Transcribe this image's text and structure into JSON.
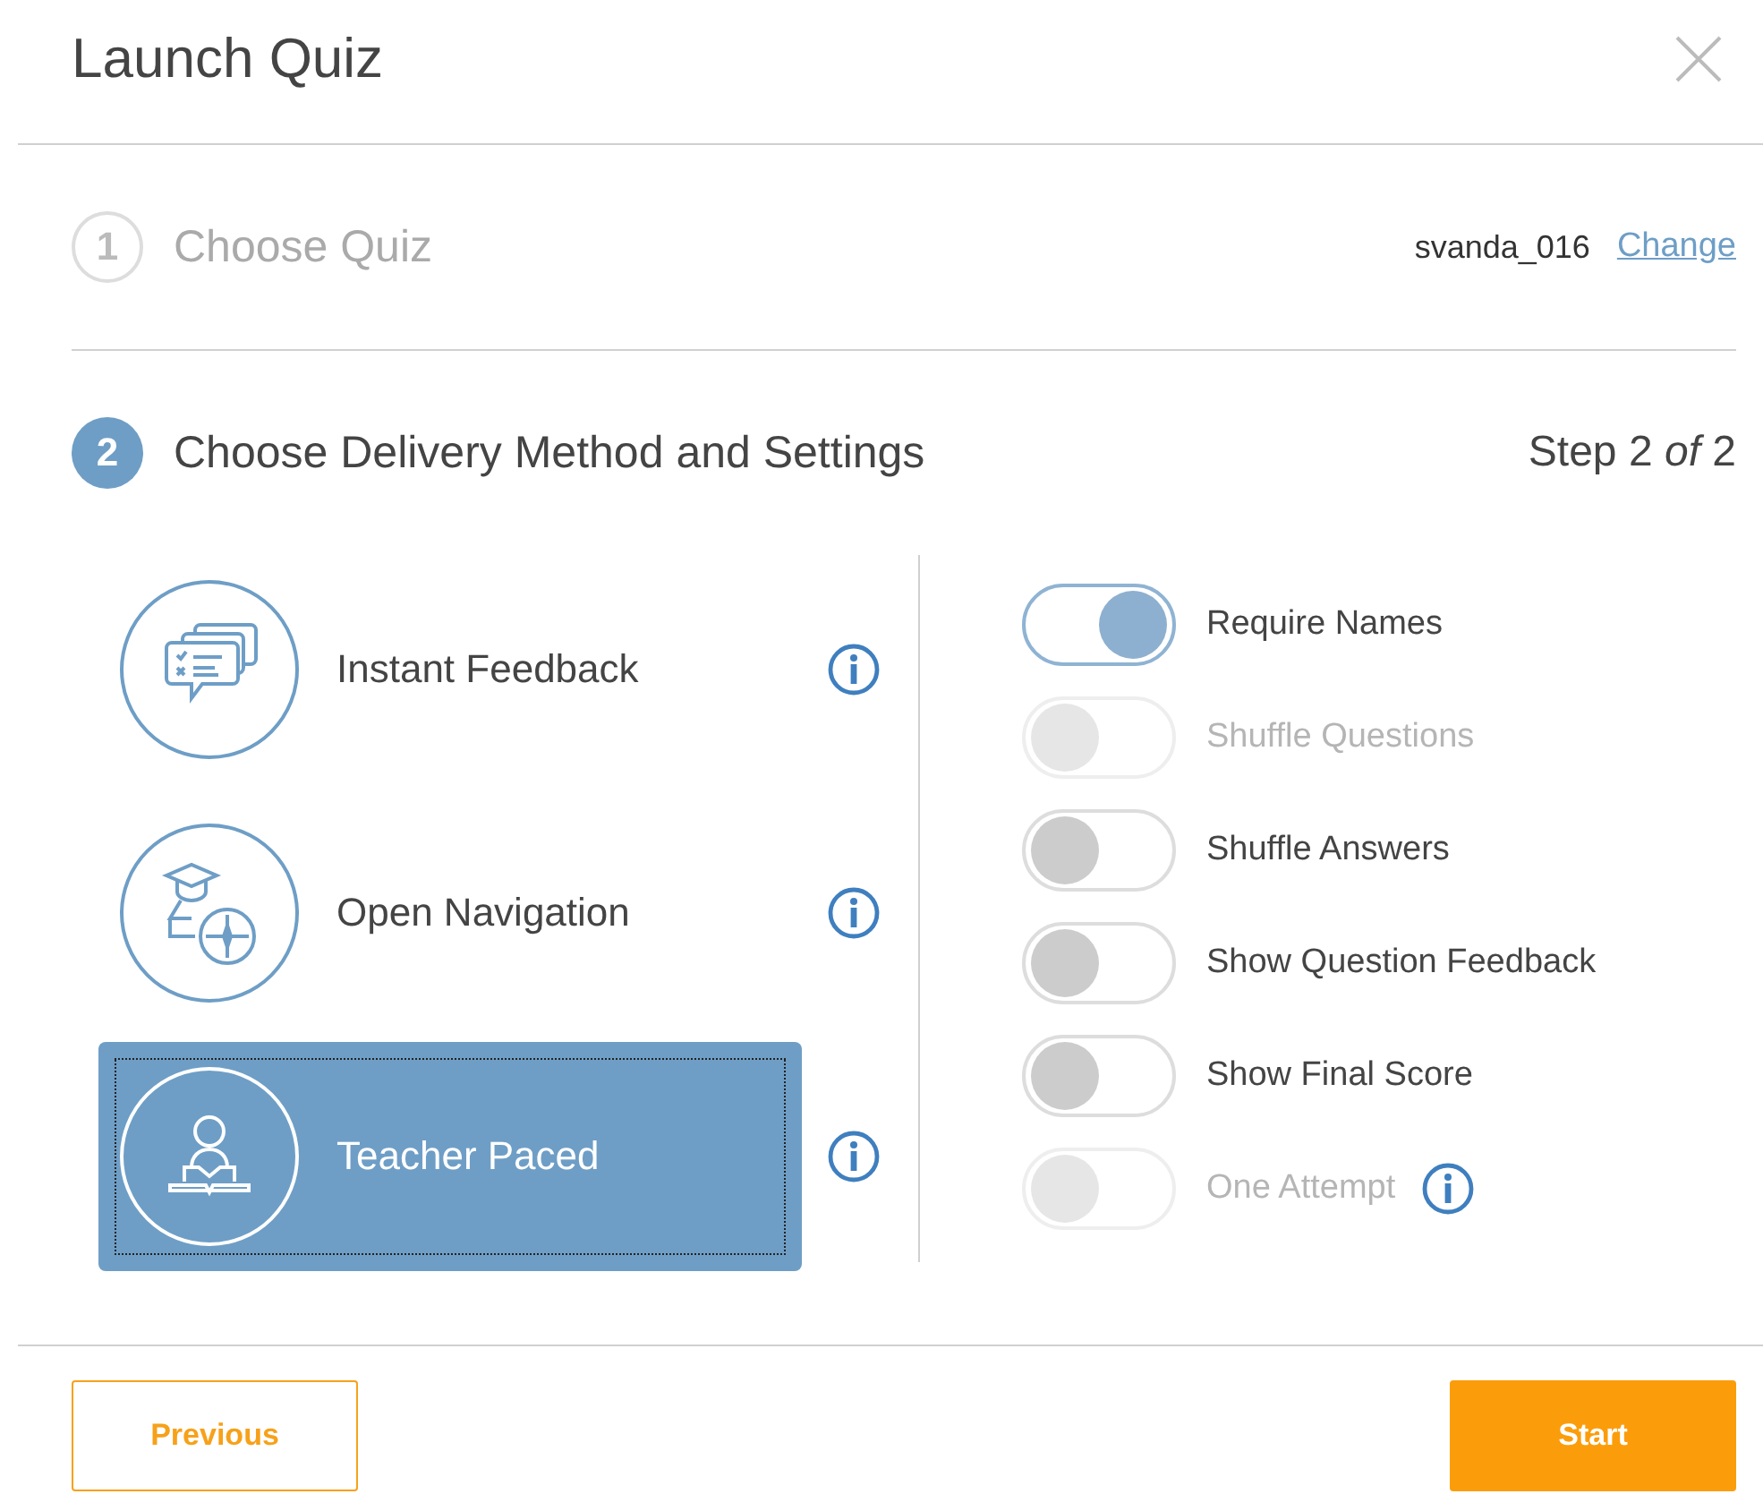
{
  "window": {
    "title": "Launch Quiz"
  },
  "steps": [
    {
      "number": "1",
      "title": "Choose Quiz",
      "active": false,
      "quiz_name": "svanda_016",
      "link": "Change"
    },
    {
      "number": "2",
      "title": "Choose Delivery Method and Settings",
      "active": true,
      "progress": "Step 2 *of* 2"
    }
  ],
  "methods": [
    {
      "kind": "feedback",
      "label": "Instant Feedback",
      "selected": false
    },
    {
      "kind": "navigation",
      "label": "Open Navigation",
      "selected": false
    },
    {
      "kind": "teacher",
      "label": "Teacher Paced",
      "selected": true
    }
  ],
  "settings": [
    {
      "label": "Require Names",
      "on": true,
      "disabled": false,
      "info": false
    },
    {
      "label": "Shuffle Questions",
      "on": false,
      "disabled": true,
      "info": false
    },
    {
      "label": "Shuffle Answers",
      "on": false,
      "disabled": false,
      "info": false
    },
    {
      "label": "Show Question Feedback",
      "on": false,
      "disabled": false,
      "info": false
    },
    {
      "label": "Show Final Score",
      "on": false,
      "disabled": false,
      "info": false
    },
    {
      "label": "One Attempt",
      "on": false,
      "disabled": true,
      "info": true
    }
  ],
  "buttons": {
    "previous": "Previous",
    "start": "Start"
  }
}
